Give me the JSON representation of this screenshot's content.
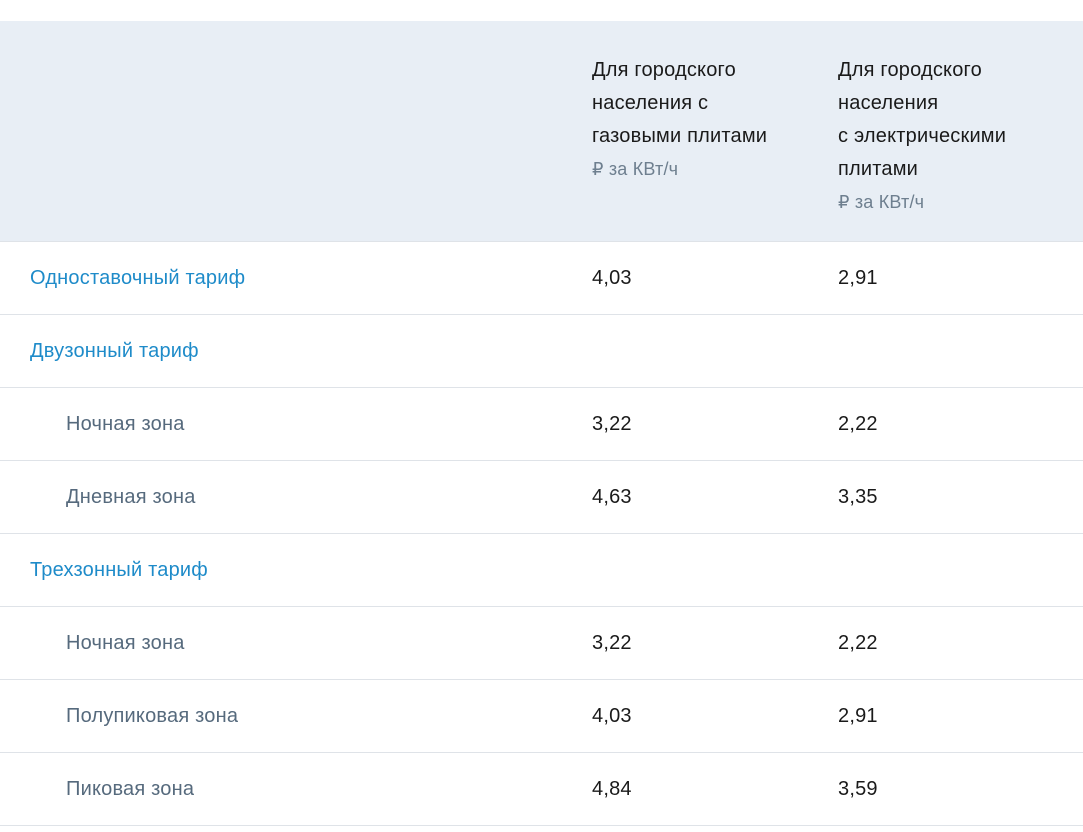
{
  "header": {
    "col_gas_title": "Для городского\nнаселения с\nгазовыми плитами",
    "col_gas_unit": "₽ за КВт/ч",
    "col_el_title": "Для городского\nнаселения\nс электрическими\nплитами",
    "col_el_unit": "₽ за КВт/ч"
  },
  "rows": [
    {
      "name": "Одноставочный тариф",
      "gas": "4,03",
      "el": "2,91"
    },
    {
      "name": "Двузонный тариф",
      "gas": "",
      "el": ""
    },
    {
      "name": "Ночная зона",
      "gas": "3,22",
      "el": "2,22"
    },
    {
      "name": "Дневная зона",
      "gas": "4,63",
      "el": "3,35"
    },
    {
      "name": "Трехзонный тариф",
      "gas": "",
      "el": ""
    },
    {
      "name": "Ночная зона",
      "gas": "3,22",
      "el": "2,22"
    },
    {
      "name": "Полупиковая зона",
      "gas": "4,03",
      "el": "2,91"
    },
    {
      "name": "Пиковая зона",
      "gas": "4,84",
      "el": "3,59"
    }
  ]
}
